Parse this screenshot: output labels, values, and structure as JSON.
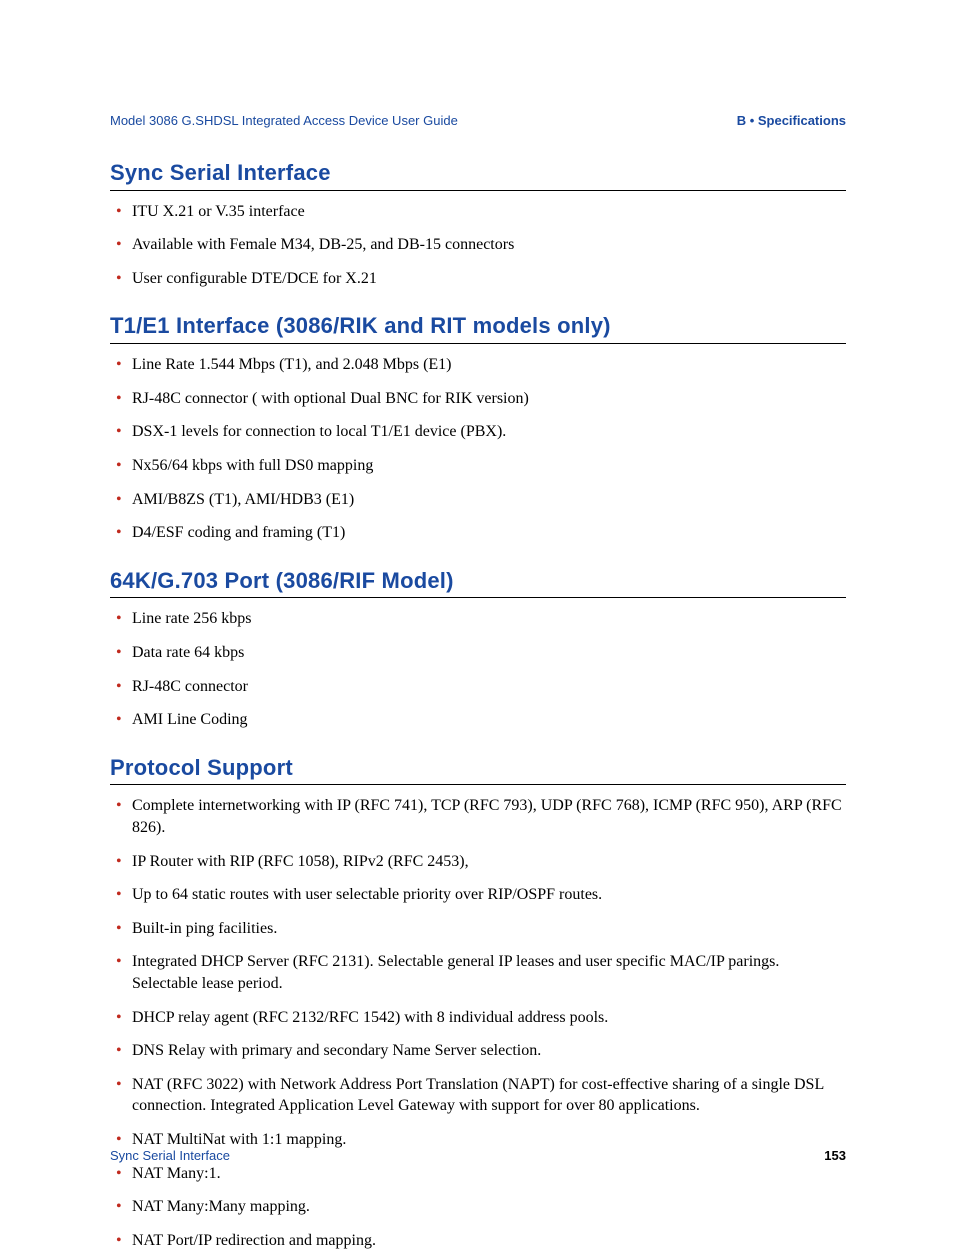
{
  "header": {
    "docTitle": "Model 3086 G.SHDSL Integrated Access Device User Guide",
    "chapter": "B • Specifications"
  },
  "sections": [
    {
      "title": "Sync Serial Interface",
      "items": [
        "ITU X.21 or V.35 interface",
        "Available with Female M34, DB-25, and DB-15 connectors",
        "User configurable DTE/DCE for X.21"
      ]
    },
    {
      "title": "T1/E1 Interface (3086/RIK and RIT models only)",
      "items": [
        "Line Rate 1.544 Mbps (T1), and 2.048 Mbps (E1)",
        "RJ-48C connector ( with optional Dual BNC for RIK version)",
        "DSX-1 levels for connection to local T1/E1 device (PBX).",
        "Nx56/64 kbps with full DS0 mapping",
        "AMI/B8ZS (T1), AMI/HDB3 (E1)",
        "D4/ESF coding and framing (T1)"
      ]
    },
    {
      "title": "64K/G.703 Port  (3086/RIF Model)",
      "items": [
        "Line rate 256 kbps",
        "Data rate 64 kbps",
        "RJ-48C connector",
        "AMI Line Coding"
      ]
    },
    {
      "title": "Protocol Support",
      "items": [
        "Complete internetworking with IP (RFC 741), TCP (RFC 793), UDP (RFC 768), ICMP (RFC 950), ARP (RFC 826).",
        "IP Router with RIP (RFC 1058), RIPv2 (RFC 2453),",
        "Up to 64 static routes with user selectable priority over RIP/OSPF routes.",
        "Built-in ping facilities.",
        "Integrated DHCP Server (RFC 2131). Selectable general IP leases and user specific MAC/IP parings. Selectable lease period.",
        "DHCP relay agent (RFC 2132/RFC 1542) with 8 individual address pools.",
        "DNS Relay with primary and secondary Name Server selection.",
        "NAT (RFC 3022) with Network Address Port Translation (NAPT) for cost-effective sharing of a single DSL connection. Integrated Application Level Gateway with support for over 80 applications.",
        "NAT MultiNat with 1:1 mapping.",
        "NAT Many:1.",
        "NAT Many:Many mapping.",
        "NAT Port/IP redirection and mapping."
      ]
    }
  ],
  "footer": {
    "left": "Sync Serial Interface",
    "pageNumber": "153"
  }
}
